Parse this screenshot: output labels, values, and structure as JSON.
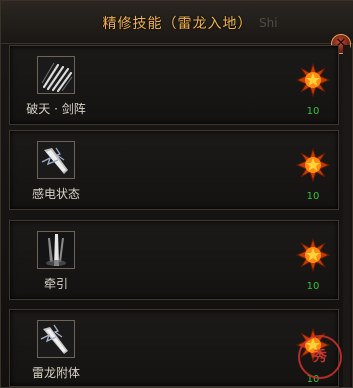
{
  "window": {
    "title": "精修技能（雷龙入地）",
    "background_text": "Shi",
    "close_label": "✕"
  },
  "skills": [
    {
      "label": "破天 · 剑阵",
      "icon": "sword-array-icon",
      "level": "10"
    },
    {
      "label": "感电状态",
      "icon": "electric-state-icon",
      "level": "10"
    },
    {
      "label": "牵引",
      "icon": "traction-icon",
      "level": "10"
    },
    {
      "label": "雷龙附体",
      "icon": "thunder-dragon-icon",
      "level": "10"
    }
  ],
  "stamp": {
    "text": "秀"
  },
  "colors": {
    "title": "#f0b24a",
    "level": "#34c23a",
    "star_outer": "#c23a08",
    "star_inner": "#ffb21a",
    "stamp": "#d83a33"
  }
}
